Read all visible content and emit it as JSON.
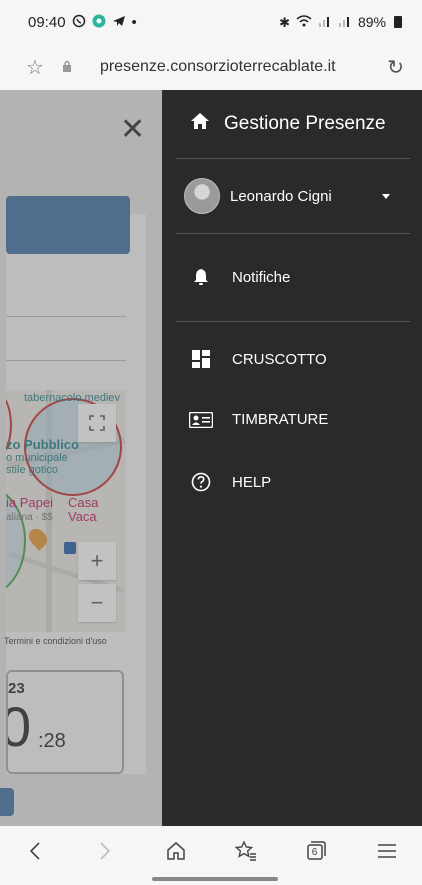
{
  "status_bar": {
    "time": "09:40",
    "battery": "89%"
  },
  "browser": {
    "url": "presenze.consorzioterrecablate.it"
  },
  "background_page": {
    "map": {
      "labels": {
        "taberna": "tabernacolo mediev",
        "palazzo": "zo Pubblico",
        "municipale": "o municipale",
        "gotico": "stile gotico",
        "papei": "ia Papei",
        "casa": "Casa Vaca",
        "italiana": "aliana · $$"
      },
      "zoom_in": "+",
      "zoom_out": "−"
    },
    "terms_text": "Termini e condizioni d'uso",
    "date_fragment": "23",
    "time_big": "0",
    "time_seconds": ":28"
  },
  "drawer": {
    "title": "Gestione Presenze",
    "user_name": "Leonardo Cigni",
    "items": [
      {
        "label": "Notifiche",
        "icon": "bell-icon"
      },
      {
        "label": "CRUSCOTTO",
        "icon": "dashboard-icon"
      },
      {
        "label": "TIMBRATURE",
        "icon": "id-card-icon"
      },
      {
        "label": "HELP",
        "icon": "help-circle-icon"
      }
    ]
  },
  "bottom_nav": {
    "tabs_count": "6"
  },
  "colors": {
    "drawer_bg": "#2a2a2a",
    "accent_blue": "#3b6fa0"
  }
}
